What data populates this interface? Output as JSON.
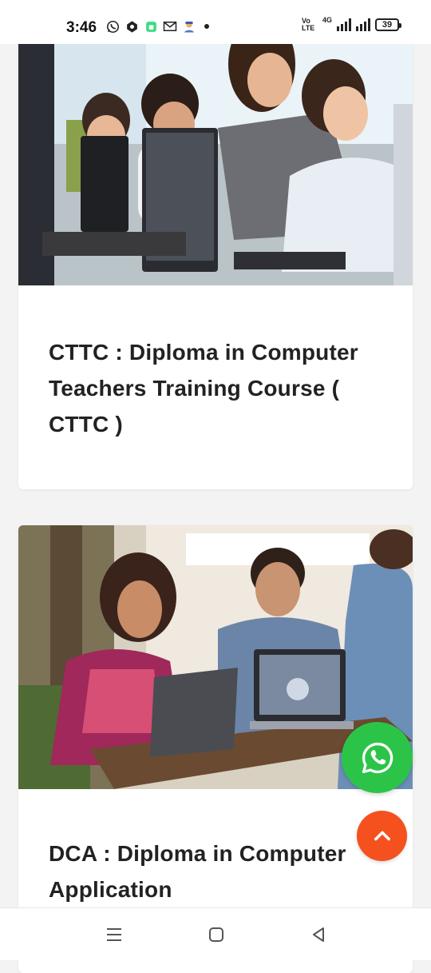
{
  "status_bar": {
    "time": "3:46",
    "left_icons": [
      "whatsapp-icon",
      "app-icon",
      "android-icon",
      "gmail-icon",
      "avatar-icon"
    ],
    "volte": "Vo LTE",
    "network": "4G",
    "battery": "39"
  },
  "cards": [
    {
      "title": "CTTC : Diploma in Computer Teachers Training Course ( CTTC )",
      "image": "computer-class-photo"
    },
    {
      "title": "DCA : Diploma in Computer Application",
      "image": "students-laptop-photo"
    }
  ],
  "floating": {
    "whatsapp": "whatsapp-icon",
    "scroll_top": "chevron-up-icon",
    "whatsapp_color": "#2cc448",
    "scroll_top_color": "#f4511e"
  },
  "nav": [
    "menu-icon",
    "home-icon",
    "back-icon"
  ]
}
